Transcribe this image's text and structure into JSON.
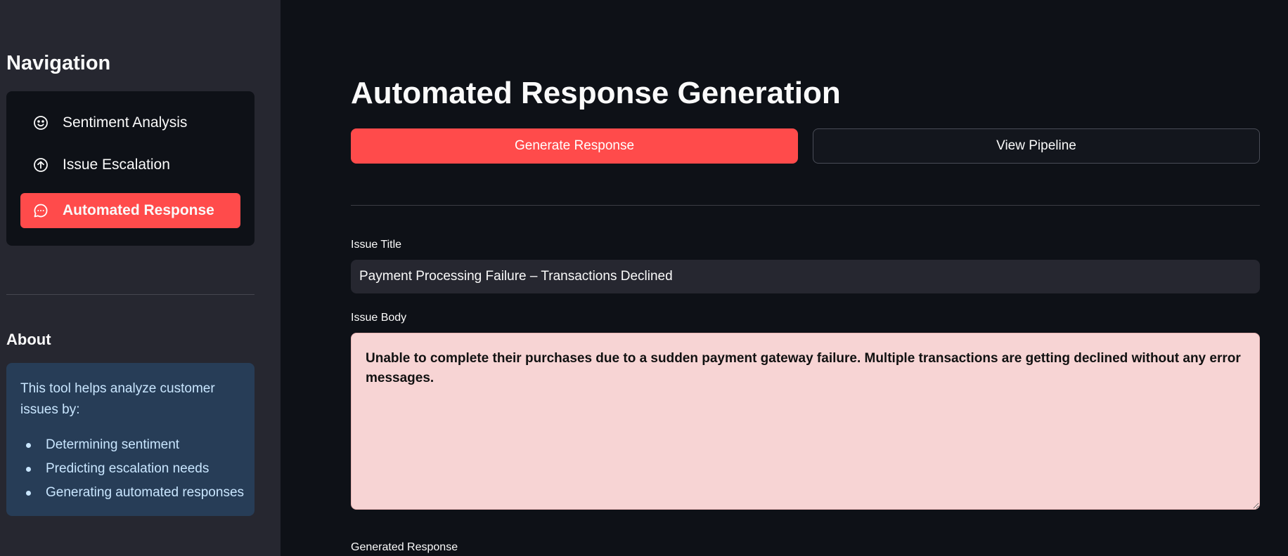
{
  "sidebar": {
    "nav_heading": "Navigation",
    "nav_items": [
      {
        "label": "Sentiment Analysis",
        "icon": "smile-icon",
        "active": false
      },
      {
        "label": "Issue Escalation",
        "icon": "arrow-up-circle-icon",
        "active": false
      },
      {
        "label": "Automated Response",
        "icon": "chat-bubble-icon",
        "active": true
      }
    ],
    "about_heading": "About",
    "about": {
      "intro": "This tool helps analyze customer issues by:",
      "items": [
        "Determining sentiment",
        "Predicting escalation needs",
        "Generating automated responses"
      ]
    }
  },
  "main": {
    "title": "Automated Response Generation",
    "generate_button": "Generate Response",
    "pipeline_button": "View Pipeline",
    "issue_title_label": "Issue Title",
    "issue_title_value": "Payment Processing Failure – Transactions Declined",
    "issue_body_label": "Issue Body",
    "issue_body_value": "Unable to complete their purchases due to a sudden payment gateway failure. Multiple transactions are getting declined without any error messages.",
    "generated_response_label": "Generated Response"
  },
  "colors": {
    "accent": "#ff4b4b",
    "background": "#0e1117",
    "sidebar": "#262730",
    "info_box": "#273d57",
    "textarea_bg": "#f7d4d4"
  }
}
